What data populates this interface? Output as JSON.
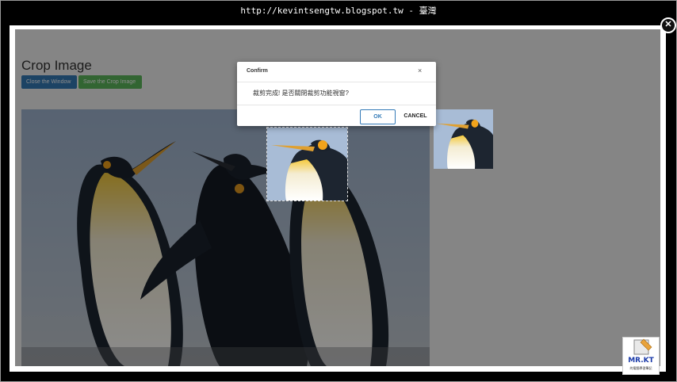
{
  "browser": {
    "url_title": "http://kevintsengtw.blogspot.tw - 臺灣"
  },
  "page": {
    "title": "Crop Image",
    "close_window_label": "Close the Window",
    "save_crop_label": "Save the Crop Image"
  },
  "dialog": {
    "title": "Confirm",
    "close_glyph": "×",
    "message": "裁剪完成! 是否關閉裁剪功能視窗?",
    "ok_label": "OK",
    "cancel_label": "CANCEL"
  },
  "viewer": {
    "close_glyph": "✕"
  },
  "logo": {
    "text": "MR.KT",
    "sub": "的電腦學習筆記"
  },
  "colors": {
    "primary": "#337ab7",
    "success": "#5cb85c"
  }
}
